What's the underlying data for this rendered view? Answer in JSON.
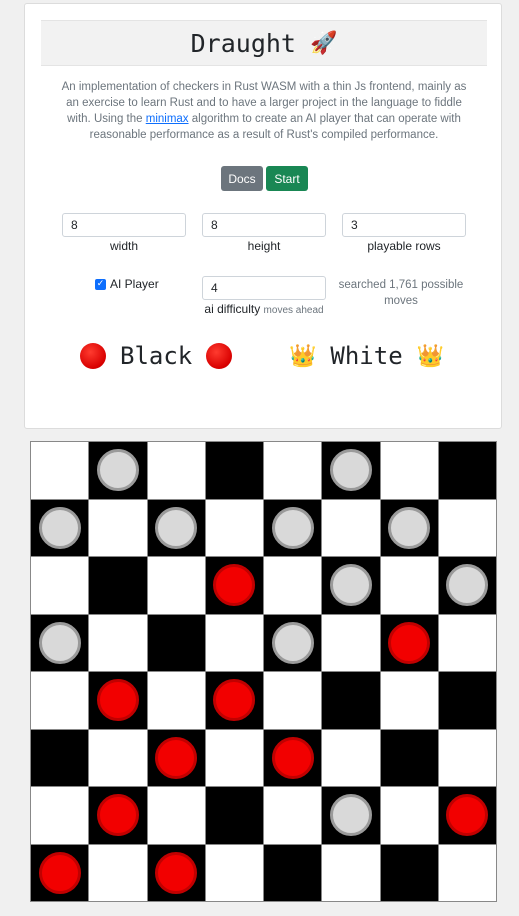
{
  "header": {
    "title": "Draught",
    "icon": "rocket-icon",
    "icon_glyph": "🚀"
  },
  "description": {
    "before_link": "An implementation of checkers in Rust WASM with a thin Js frontend, mainly as an exercise to learn Rust and to have a larger project in the language to fiddle with. Using the ",
    "link_text": "minimax",
    "after_link": " algorithm to create an AI player that can operate with reasonable performance as a result of Rust's compiled performance."
  },
  "buttons": {
    "docs_label": "Docs",
    "start_label": "Start"
  },
  "settings": {
    "width_value": "8",
    "width_label": "width",
    "height_value": "8",
    "height_label": "height",
    "playable_rows_value": "3",
    "playable_rows_label": "playable rows",
    "ai_player_label": "AI Player",
    "ai_player_checked": true,
    "ai_difficulty_value": "4",
    "ai_difficulty_label": "ai difficulty",
    "ai_difficulty_hint": "moves ahead",
    "searched_text": "searched 1,761 possible moves"
  },
  "players": {
    "black_label": "Black",
    "black_icon": "red-circle-icon",
    "white_label": "White",
    "white_icon": "crown-icon",
    "white_icon_glyph": "👑"
  },
  "colors": {
    "docs_button": "#6c757d",
    "start_button": "#198754",
    "black_piece": "#f20000",
    "white_piece": "#d9d9d9",
    "dark_square": "#000000",
    "light_square": "#ffffff"
  },
  "board": {
    "rows": [
      [
        "",
        "W",
        "",
        "",
        "",
        "W",
        "",
        ""
      ],
      [
        "W",
        "",
        "W",
        "",
        "W",
        "",
        "W",
        ""
      ],
      [
        "",
        "",
        "",
        "B",
        "",
        "W",
        "",
        "W"
      ],
      [
        "W",
        "",
        "",
        "",
        "W",
        "",
        "B",
        ""
      ],
      [
        "",
        "B",
        "",
        "B",
        "",
        "",
        "",
        ""
      ],
      [
        "",
        "",
        "B",
        "",
        "B",
        "",
        "",
        ""
      ],
      [
        "",
        "B",
        "",
        "",
        "",
        "W",
        "",
        "B"
      ],
      [
        "B",
        "",
        "B",
        "",
        "",
        "",
        "",
        ""
      ]
    ]
  }
}
